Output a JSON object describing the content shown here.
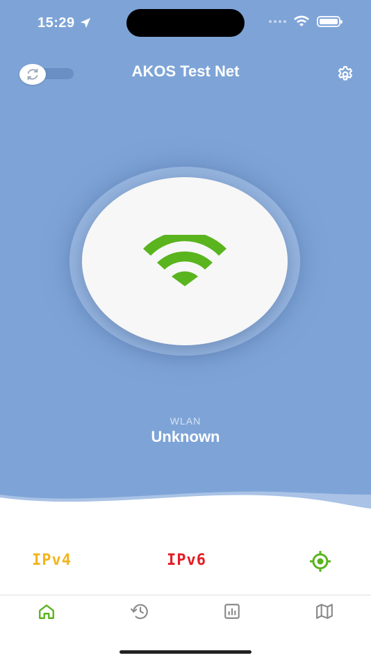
{
  "status_bar": {
    "time": "15:29",
    "icons": [
      "location-arrow-icon",
      "signal-icon",
      "wifi-icon",
      "battery-icon"
    ]
  },
  "header": {
    "title": "AKOS Test Net",
    "auto_toggle_icon": "sync-icon",
    "settings_icon": "gear-icon"
  },
  "main": {
    "start_button_icon": "wifi-icon",
    "network_type": "WLAN",
    "network_name": "Unknown"
  },
  "indicators": {
    "ipv4_label": "IPv4",
    "ipv6_label": "IPv6",
    "location_icon": "location-target-icon"
  },
  "tab_bar": {
    "items": [
      {
        "icon": "home-icon",
        "active": true
      },
      {
        "icon": "history-icon",
        "active": false
      },
      {
        "icon": "statistics-icon",
        "active": false
      },
      {
        "icon": "map-icon",
        "active": false
      }
    ]
  },
  "colors": {
    "hero_background": "#7ea4d7",
    "accent_green": "#5ab41e",
    "ipv4_color": "#f2b51c",
    "ipv6_color": "#e31c25",
    "tab_inactive": "#8a8a8a"
  }
}
